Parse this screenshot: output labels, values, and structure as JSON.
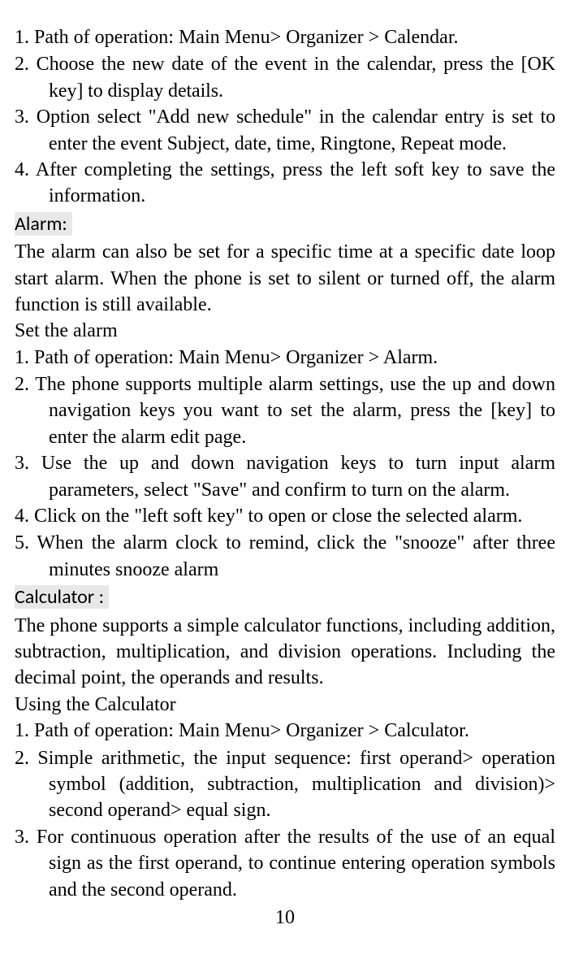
{
  "calendar": {
    "item1": "1. Path of operation: Main Menu> Organizer > Calendar.",
    "item2": "2. Choose the new date of the event in the calendar, press the [OK key] to display details.",
    "item3": "3. Option select \"Add new schedule\" in the calendar entry is set to enter the event Subject, date, time, Ringtone, Repeat mode.",
    "item4": "4. After completing the settings, press the left soft key to save the information."
  },
  "alarm": {
    "heading": "Alarm:",
    "intro": "The alarm can also be set for a specific time at a specific date loop start alarm. When the phone is set to silent or turned off, the alarm function is still available.",
    "subheading": "Set the alarm",
    "item1": "1. Path of operation: Main Menu> Organizer > Alarm.",
    "item2": "2. The phone supports multiple alarm settings, use the up and down navigation keys you want to set the alarm, press the [key] to enter the alarm edit page.",
    "item3": "3. Use the up and down navigation keys to turn input alarm parameters, select \"Save\" and confirm to turn on the alarm.",
    "item4": "4. Click on the \"left soft key\" to open or close the selected alarm.",
    "item5": "5. When the alarm clock to remind, click the \"snooze\" after three minutes snooze alarm"
  },
  "calculator": {
    "heading": "Calculator :",
    "intro": "The phone supports a simple calculator functions, including addition, subtraction, multiplication, and division operations. Including the decimal point, the operands and results.",
    "subheading": "Using the Calculator",
    "item1": "1. Path of operation: Main Menu> Organizer > Calculator.",
    "item2": "2. Simple arithmetic, the input sequence: first operand> operation symbol (addition, subtraction, multiplication and division)> second operand> equal sign.",
    "item3": "3. For continuous operation after the results of the use of an equal sign as the first operand, to continue entering operation symbols and the second operand."
  },
  "page_number": "10"
}
